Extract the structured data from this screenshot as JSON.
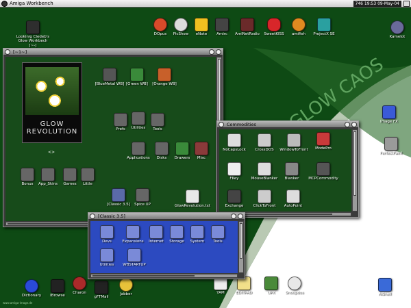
{
  "menubar": {
    "title": "Amiga Workbench",
    "status": "746 19:53 09-May-04"
  },
  "desktop": {
    "top_left_icon": {
      "label1": "Lookinig Cledeb's",
      "label2": "Glow Workbech",
      "sub": "[~-]"
    },
    "top_icons": [
      "DOpus",
      "PicShow",
      "eNote",
      "Amirc",
      "AmiNetRadio",
      "SweetKISS",
      "amifish",
      "ProjectX SE"
    ],
    "right_top": "Kamelot",
    "right_icons": [
      "Image FX",
      "PerfectPaint"
    ],
    "watermark": "GLOW CAOS",
    "bottom_icons": [
      "Dictionary",
      "IBrowse",
      "Charon",
      "gFTMail",
      "Jabber",
      "YAM",
      "EDITPAD",
      "UPX",
      "Snoopdos",
      "AiShell"
    ],
    "bottom_url": "www.amiga-image.de"
  },
  "main_window": {
    "title": "[~1~]",
    "poster_text": "GLOW REVOLUTION",
    "poster_caption": "<>",
    "icons": [
      "[BlueMetal WB]",
      "[Green WB]",
      "[Orange WB]",
      "Prefs",
      "Utilities",
      "Tools",
      "Applications",
      "Disks",
      "Drawers",
      "Misc",
      "Bonus",
      "App_Skins",
      "Games",
      "Little",
      "[Classic 3.5]",
      "Spice XP",
      "GlowRevolution.txt"
    ]
  },
  "commodities_window": {
    "title": "Commodities",
    "icons": [
      "NoCapsLock",
      "CrossDOS",
      "WindowToFront",
      "ModePro",
      "FKey",
      "MouseBlanker",
      "Blanker",
      "MCPCommodity",
      "Exchange",
      "ClickToFront",
      "AutoPoint"
    ]
  },
  "classic_window": {
    "title": "[Classic 3.5]",
    "icons": [
      "Devs",
      "Expansions",
      "Internet",
      "Storage",
      "System",
      "Tools",
      "Utilities",
      "WBSTARTUP"
    ]
  },
  "colors": {
    "bg_green": "#0e4a14",
    "window_green": "#174b1a",
    "chrome_gray": "#9a9a9a"
  }
}
